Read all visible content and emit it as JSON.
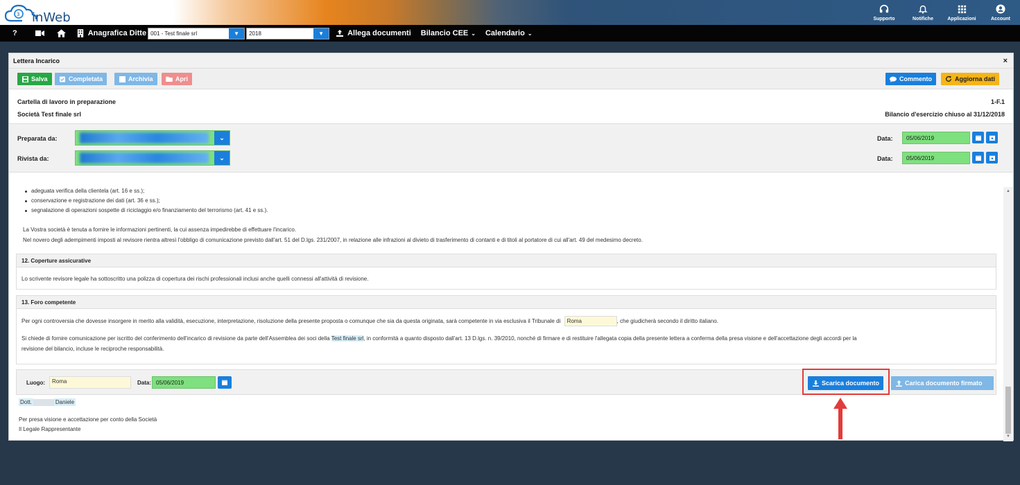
{
  "header": {
    "logo_text": "inWeb",
    "actions": [
      {
        "label": "Supporto",
        "icon": "headset-icon"
      },
      {
        "label": "Notifiche",
        "icon": "bell-icon"
      },
      {
        "label": "Applicazioni",
        "icon": "grid-icon"
      },
      {
        "label": "Account",
        "icon": "user-icon"
      }
    ]
  },
  "navbar": {
    "help": "?",
    "anagrafica_label": "Anagrafica Ditte",
    "company_select": "001 - Test finale srl",
    "year_select": "2018",
    "allega_label": "Allega documenti",
    "bilancio_label": "Bilancio CEE",
    "calendario_label": "Calendario"
  },
  "modal": {
    "title": "Lettera Incarico",
    "close": "×",
    "toolbar": {
      "salva": "Salva",
      "completata": "Completata",
      "archivia": "Archivia",
      "apri": "Apri",
      "commento": "Commento",
      "aggiorna": "Aggiorna dati"
    },
    "info": {
      "cartella": "Cartella di lavoro in preparazione",
      "code": "1-F.1",
      "societa": "Società Test finale srl",
      "bilancio": "Bilancio d'esercizio chiuso al 31/12/2018"
    },
    "prep": {
      "preparata_label": "Preparata da:",
      "rivista_label": "Rivista da:",
      "data_label": "Data:",
      "data_preparata": "05/06/2019",
      "data_rivista": "05/06/2019"
    },
    "content": {
      "bullets": [
        "adeguata verifica della clientela (art. 16 e ss.);",
        "conservazione e registrazione dei dati (art. 36 e ss.);",
        "segnalazione di operazioni sospette di riciclaggio e/o finanziamento del terrorismo (art. 41 e ss.)."
      ],
      "para1": "La Vostra società è tenuta a fornire le informazioni pertinenti, la cui assenza impedirebbe di effettuare l'incarico.",
      "para2": "Nel novero degli adempimenti imposti al revisore rientra altresì l'obbligo di comunicazione previsto dall'art. 51 del D.lgs. 231/2007, in relazione alle infrazioni al divieto di trasferimento di contanti e di titoli al portatore di cui all'art. 49 del medesimo decreto.",
      "sec12_title": "12. Coperture assicurative",
      "sec12_text": "Lo scrivente revisore legale ha sottoscritto una polizza di copertura dei rischi professionali inclusi anche quelli connessi all'attività di revisione.",
      "sec13_title": "13. Foro competente",
      "sec13_text_a": "Per ogni controversia che dovesse insorgere in merito alla validità, esecuzione, interpretazione, risoluzione della presente proposta o comunque che sia da questa originata, sarà competente in via esclusiva il Tribunale di",
      "sec13_tribunale": "Roma",
      "sec13_text_b": ", che giudicherà secondo il diritto italiano.",
      "sec13_p2_a": "Si chiede di fornire comunicazione per iscritto del conferimento dell'incarico di revisione da parte dell'Assemblea dei soci della",
      "sec13_p2_company": "Test finale srl",
      "sec13_p2_b": ", in conformità a quanto disposto dall'art. 13 D.lgs. n. 39/2010, nonché di firmare e di restituire l'allegata copia della presente lettera a conferma della presa visione e dell'accettazione degli accordi per la",
      "sec13_p2_c": "revisione del bilancio, incluse le reciproche responsabilità.",
      "luogo_label": "Luogo:",
      "luogo_value": "Roma",
      "data_label": "Data:",
      "data_value": "05/06/2019",
      "scarica": "Scarica documento",
      "carica": "Carica documento firmato",
      "dott": "Dott.",
      "dott_name": "Daniele",
      "presa": "Per presa visione e accettazione per conto della Società",
      "legale": "Il Legale Rappresentante"
    }
  },
  "colors": {
    "salva": "#28a745",
    "completata": "#7fb7e6",
    "archivia": "#7fb7e6",
    "apri": "#ef8e8e",
    "commento": "#1a7fdc",
    "aggiorna": "#f5b418",
    "accent": "#1a7fdc",
    "highlight_red": "#e33b3b"
  }
}
